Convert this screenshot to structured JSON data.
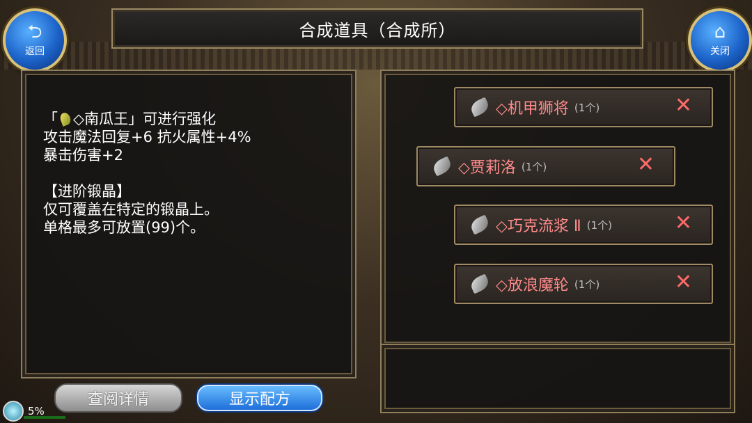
{
  "header": {
    "title": "合成道具（合成所）",
    "back_label": "返回",
    "close_label": "关闭"
  },
  "description": {
    "line1_prefix": "「",
    "line1_name": "◇南瓜王",
    "line1_suffix": "」可进行强化",
    "line2": "攻击魔法回复+6 抗火属性+4%",
    "line3": "暴击伤害+2",
    "line4": "【进阶锻晶】",
    "line5": "仅可覆盖在特定的锻晶上。",
    "line6": "单格最多可放置(99)个。"
  },
  "items": [
    {
      "name": "◇机甲狮将",
      "qty": "(1个)"
    },
    {
      "name": "◇贾莉洛",
      "qty": "(1个)"
    },
    {
      "name": "◇巧克流浆 Ⅱ",
      "qty": "(1个)"
    },
    {
      "name": "◇放浪魔轮",
      "qty": "(1个)"
    }
  ],
  "buttons": {
    "details": "查阅详情",
    "recipe": "显示配方"
  },
  "status": {
    "percent": "5%"
  },
  "colors": {
    "accent_blue": "#1a6ad8",
    "item_name": "#ff8b8b",
    "remove_x": "#ff6a6a",
    "frame_gold": "#9c8a63"
  }
}
